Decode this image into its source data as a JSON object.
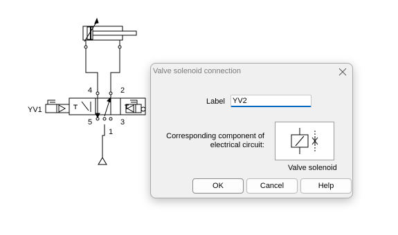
{
  "schematic": {
    "valve_tag": "YV1",
    "port_labels": [
      "4",
      "2",
      "5",
      "3",
      "1"
    ]
  },
  "dialog": {
    "title": "Valve solenoid connection",
    "label_caption": "Label",
    "label_value": "YV2",
    "component_caption_line1": "Corresponding component of",
    "component_caption_line2": "electrical circuit:",
    "preview_caption": "Valve solenoid",
    "buttons": {
      "ok": "OK",
      "cancel": "Cancel",
      "help": "Help"
    },
    "icons": {
      "close": "close-icon",
      "preview": "valve-solenoid-icon"
    }
  }
}
